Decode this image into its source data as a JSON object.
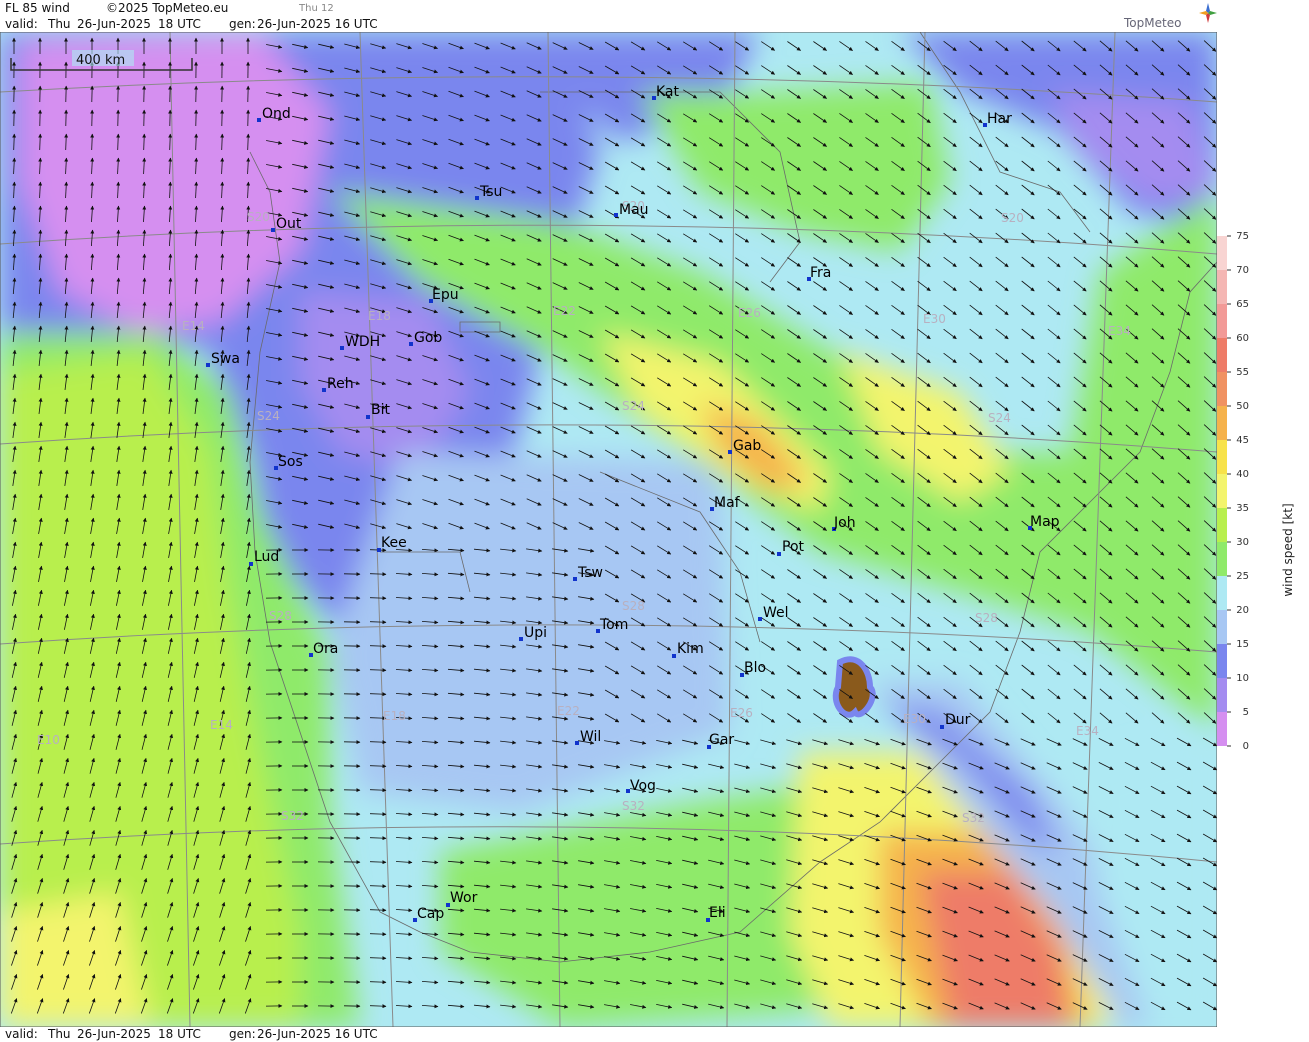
{
  "header": {
    "title": "FL 85 wind",
    "copyright": "©2025 TopMeteo.eu",
    "step": "Thu 12",
    "valid_label": "valid:",
    "valid_day": "Thu",
    "valid_date": "26-Jun-2025",
    "valid_time": "18 UTC",
    "gen_label": "gen:",
    "gen_value": "26-Jun-2025 16 UTC",
    "brand": "TopMeteo"
  },
  "footer": {
    "valid_label": "valid:",
    "valid_day": "Thu",
    "valid_date": "26-Jun-2025",
    "valid_time": "18 UTC",
    "gen_label": "gen:",
    "gen_value": "26-Jun-2025 16 UTC"
  },
  "map": {
    "scale_label": "400 km",
    "cities": [
      {
        "name": "Ond"
      },
      {
        "name": "Kat"
      },
      {
        "name": "Har"
      },
      {
        "name": "Tsu"
      },
      {
        "name": "Mau"
      },
      {
        "name": "Out"
      },
      {
        "name": "Fra"
      },
      {
        "name": "Epu"
      },
      {
        "name": "WDH"
      },
      {
        "name": "Gob"
      },
      {
        "name": "Swa"
      },
      {
        "name": "Reh"
      },
      {
        "name": "Bit"
      },
      {
        "name": "Gab"
      },
      {
        "name": "Sos"
      },
      {
        "name": "Maf"
      },
      {
        "name": "Joh"
      },
      {
        "name": "Map"
      },
      {
        "name": "Kee"
      },
      {
        "name": "Pot"
      },
      {
        "name": "Lud"
      },
      {
        "name": "Tsw"
      },
      {
        "name": "Wel"
      },
      {
        "name": "Upi"
      },
      {
        "name": "Tom"
      },
      {
        "name": "Ora"
      },
      {
        "name": "Kim"
      },
      {
        "name": "Blo"
      },
      {
        "name": "Dur"
      },
      {
        "name": "Wil"
      },
      {
        "name": "Gar"
      },
      {
        "name": "Vog"
      },
      {
        "name": "Wor"
      },
      {
        "name": "Cap"
      },
      {
        "name": "Eli"
      }
    ],
    "grid_labels": [
      {
        "text": "S20"
      },
      {
        "text": "S20"
      },
      {
        "text": "S20"
      },
      {
        "text": "E14"
      },
      {
        "text": "E18"
      },
      {
        "text": "E22"
      },
      {
        "text": "E26"
      },
      {
        "text": "E30"
      },
      {
        "text": "E34"
      },
      {
        "text": "S24"
      },
      {
        "text": "S24"
      },
      {
        "text": "S24"
      },
      {
        "text": "S28"
      },
      {
        "text": "S28"
      },
      {
        "text": "S28"
      },
      {
        "text": "E10"
      },
      {
        "text": "E14"
      },
      {
        "text": "E18"
      },
      {
        "text": "E22"
      },
      {
        "text": "E26"
      },
      {
        "text": "E30"
      },
      {
        "text": "E34"
      },
      {
        "text": "S32"
      },
      {
        "text": "S32"
      },
      {
        "text": "S32"
      }
    ]
  },
  "legend": {
    "title": "wind speed [kt]",
    "ticks": [
      "0",
      "5",
      "10",
      "15",
      "20",
      "25",
      "30",
      "35",
      "40",
      "45",
      "50",
      "55",
      "60",
      "65",
      "70",
      "75"
    ],
    "colors": [
      "#d58ff0",
      "#a48cf0",
      "#7a86ee",
      "#a7c7f3",
      "#aee9f3",
      "#8fea6a",
      "#b8ef4e",
      "#f3f46d",
      "#f7e24a",
      "#f5b24c",
      "#f09262",
      "#ee7c68",
      "#f29a97",
      "#f4b6b3",
      "#f8d4d2",
      "#ffffff"
    ]
  },
  "colors": {
    "city_marker": "#1133cc",
    "grid_line": "#8a8a8a",
    "grid_label": "#b8b0c0"
  }
}
